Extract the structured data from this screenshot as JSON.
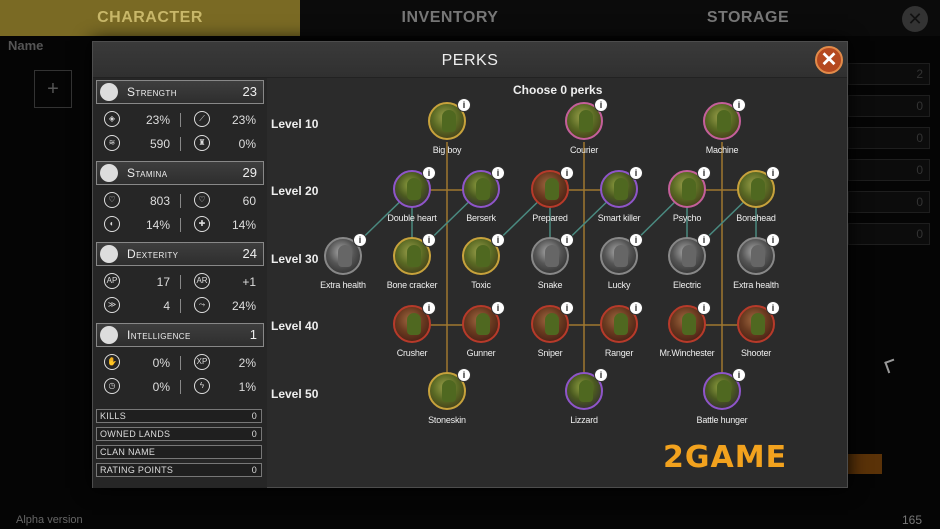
{
  "tabs": [
    "CHARACTER",
    "INVENTORY",
    "STORAGE"
  ],
  "background": {
    "name_label": "Name",
    "plus": "+",
    "side_values": [
      "2",
      "0",
      "0",
      "0",
      "0",
      "0"
    ],
    "footer_left": "Alpha version",
    "footer_right": "165"
  },
  "modal": {
    "title": "PERKS",
    "close": "✕",
    "choose": "Choose 0 perks"
  },
  "stats": [
    {
      "name": "Strength",
      "value": "23",
      "icon": "fist-icon",
      "rows": [
        [
          "23%",
          "23%"
        ],
        [
          "590",
          "0%"
        ]
      ]
    },
    {
      "name": "Stamina",
      "value": "29",
      "icon": "heart-icon",
      "rows": [
        [
          "803",
          "60"
        ],
        [
          "14%",
          "14%"
        ]
      ]
    },
    {
      "name": "Dexterity",
      "value": "24",
      "icon": "target-icon",
      "rows": [
        [
          "17",
          "+1"
        ],
        [
          "4",
          "24%"
        ]
      ]
    },
    {
      "name": "Intelligence",
      "value": "1",
      "icon": "gear-icon",
      "rows": [
        [
          "0%",
          "2%"
        ],
        [
          "0%",
          "1%"
        ]
      ]
    }
  ],
  "info": [
    {
      "label": "KILLS",
      "value": "0"
    },
    {
      "label": "OWNED LANDS",
      "value": "0"
    },
    {
      "label": "CLAN NAME",
      "value": ""
    },
    {
      "label": "RATING POINTS",
      "value": "0"
    }
  ],
  "levels": [
    "Level 10",
    "Level 20",
    "Level 30",
    "Level 40",
    "Level 50"
  ],
  "perks": [
    {
      "name": "Big boy",
      "style": "gold"
    },
    {
      "name": "Courier",
      "style": "pink"
    },
    {
      "name": "Machine",
      "style": "pink"
    },
    {
      "name": "Double heart",
      "style": "purple"
    },
    {
      "name": "Berserk",
      "style": "purple"
    },
    {
      "name": "Prepared",
      "style": "red"
    },
    {
      "name": "Smart killer",
      "style": "purple"
    },
    {
      "name": "Psycho",
      "style": "pink"
    },
    {
      "name": "Bonehead",
      "style": "gold"
    },
    {
      "name": "Extra health",
      "style": "locked"
    },
    {
      "name": "Bone cracker",
      "style": "gold"
    },
    {
      "name": "Toxic",
      "style": "gold"
    },
    {
      "name": "Snake",
      "style": "locked"
    },
    {
      "name": "Lucky",
      "style": "locked"
    },
    {
      "name": "Electric",
      "style": "locked"
    },
    {
      "name": "Extra health",
      "style": "locked"
    },
    {
      "name": "Crusher",
      "style": "red"
    },
    {
      "name": "Gunner",
      "style": "red"
    },
    {
      "name": "Sniper",
      "style": "red"
    },
    {
      "name": "Ranger",
      "style": "red"
    },
    {
      "name": "Mr.Winchester",
      "style": "red"
    },
    {
      "name": "Shooter",
      "style": "red"
    },
    {
      "name": "Stoneskin",
      "style": "gold"
    },
    {
      "name": "Lizzard",
      "style": "purple"
    },
    {
      "name": "Battle hunger",
      "style": "purple"
    }
  ],
  "logo": "2GAME"
}
